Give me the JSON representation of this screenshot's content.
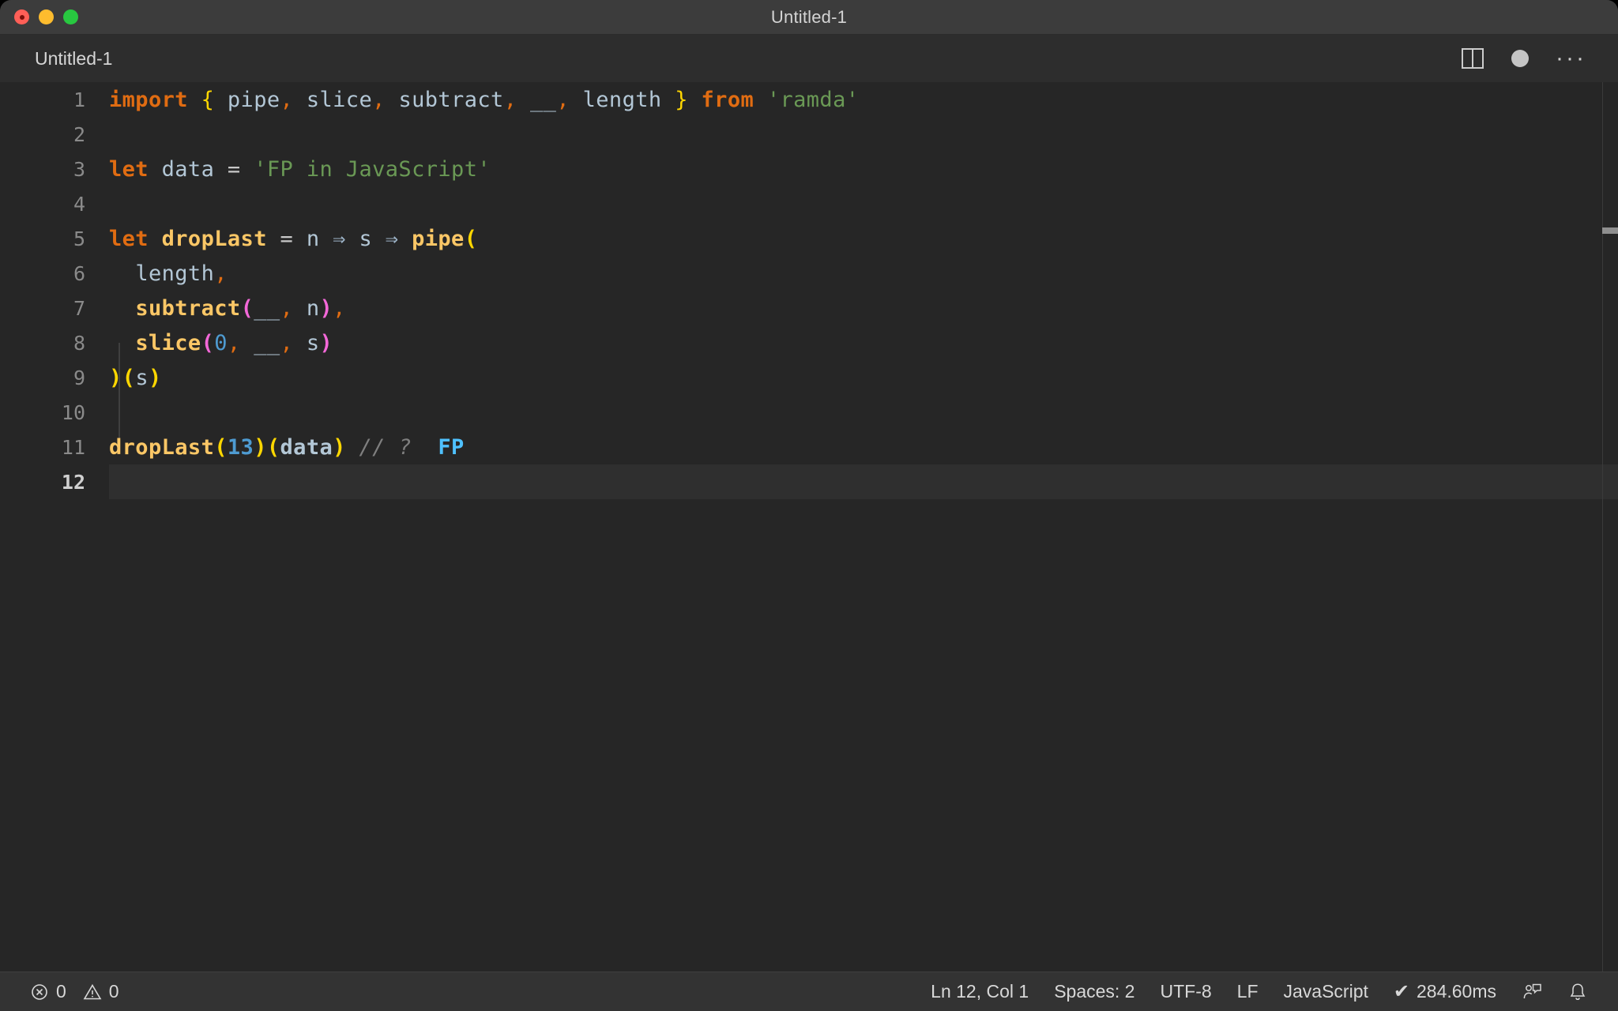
{
  "window": {
    "title": "Untitled-1",
    "traffic_lights": [
      "close-red",
      "minimize-yellow",
      "maximize-green"
    ]
  },
  "tab": {
    "label": "Untitled-1",
    "actions": {
      "split_editor": "split-editor-icon",
      "unsaved_indicator": "dirty-dot",
      "more_actions": "···"
    }
  },
  "editor": {
    "language": "JavaScript",
    "lines": [
      {
        "n": "1",
        "marker": false
      },
      {
        "n": "2",
        "marker": false
      },
      {
        "n": "3",
        "marker": true
      },
      {
        "n": "4",
        "marker": false
      },
      {
        "n": "5",
        "marker": true
      },
      {
        "n": "6",
        "marker": false
      },
      {
        "n": "7",
        "marker": false
      },
      {
        "n": "8",
        "marker": false
      },
      {
        "n": "9",
        "marker": false
      },
      {
        "n": "10",
        "marker": false
      },
      {
        "n": "11",
        "marker": true
      },
      {
        "n": "12",
        "marker": false
      }
    ],
    "source": {
      "l1": "import { pipe, slice, subtract, __, length } from 'ramda'",
      "l3": "let data = 'FP in JavaScript'",
      "l5": "let dropLast = n => s => pipe(",
      "l6": "  length,",
      "l7": "  subtract(__, n),",
      "l8": "  slice(0, __, s)",
      "l9": ")(s)",
      "l11": "dropLast(13)(data) // ?  FP"
    },
    "tokens": {
      "t_import": "import",
      "t_brace_open": "{",
      "t_pipe": "pipe",
      "t_comma": ",",
      "t_slice": "slice",
      "t_subtract": "subtract",
      "t_underscore": "__",
      "t_length": "length",
      "t_brace_close": "}",
      "t_from": "from",
      "t_ramda": "'ramda'",
      "t_let": "let",
      "t_data": "data",
      "t_eq": "=",
      "t_fpstring": "'FP in JavaScript'",
      "t_droplast": "dropLast",
      "t_n": "n",
      "t_arrow": "⇒",
      "t_s": "s",
      "t_pipe_open": "pipe(",
      "t_length_c": "length,",
      "t_subtract_name": "subtract",
      "t_paren_open": "(",
      "t_paren_close": ")",
      "t_slice_name": "slice",
      "t_zero": "0",
      "t_close_call": ")(s)",
      "t_droplast_call": "dropLast",
      "t_thirteen": "13",
      "t_data_arg": "data",
      "t_comment": "// ?",
      "t_quokka_value": "FP"
    }
  },
  "statusbar": {
    "errors_icon": "error-circle-icon",
    "errors": "0",
    "warnings_icon": "warning-triangle-icon",
    "warnings": "0",
    "cursor_position": "Ln 12, Col 1",
    "indentation": "Spaces: 2",
    "encoding": "UTF-8",
    "eol": "LF",
    "language_mode": "JavaScript",
    "quokka_check": "✔",
    "quokka_time": "284.60ms",
    "feedback_icon": "feedback-person-icon",
    "bell_icon": "bell-icon"
  }
}
